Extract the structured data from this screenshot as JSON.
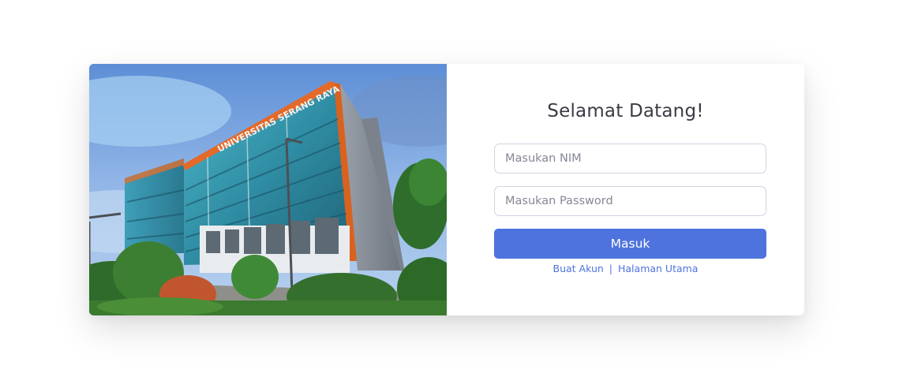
{
  "photo": {
    "alt": "Gedung Universitas Serang Raya",
    "building_sign": "UNIVERSITAS SERANG RAYA"
  },
  "login": {
    "title": "Selamat Datang!",
    "nim_placeholder": "Masukan NIM",
    "password_placeholder": "Masukan Password",
    "submit_label": "Masuk",
    "register_link": "Buat Akun",
    "separator": "|",
    "home_link": "Halaman Utama"
  },
  "colors": {
    "primary": "#4e73df",
    "title_text": "#3a3b45",
    "input_border": "#d1d3e2"
  }
}
